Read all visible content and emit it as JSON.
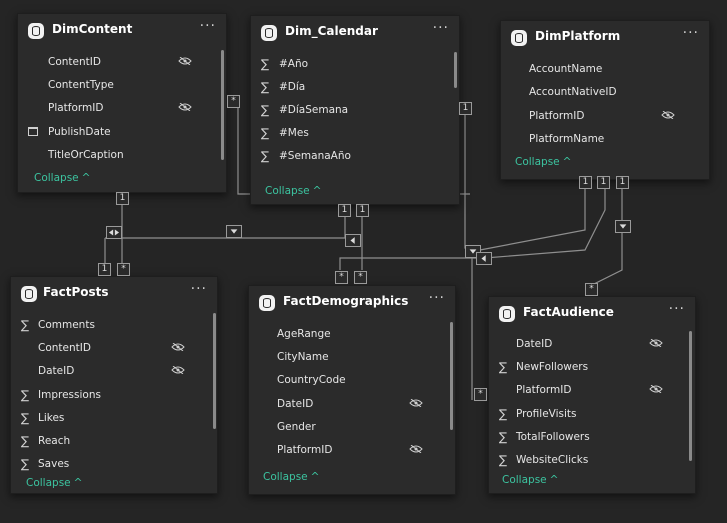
{
  "tables": {
    "dimcontent": {
      "title": "DimContent",
      "more": "···",
      "fields": [
        {
          "name": "ContentID",
          "icon": "none",
          "hidden": true
        },
        {
          "name": "ContentType",
          "icon": "none",
          "hidden": false
        },
        {
          "name": "PlatformID",
          "icon": "none",
          "hidden": true
        },
        {
          "name": "PublishDate",
          "icon": "calendar-icon",
          "hidden": false
        },
        {
          "name": "TitleOrCaption",
          "icon": "none",
          "hidden": false
        }
      ],
      "collapse": "Collapse"
    },
    "dim_calendar": {
      "title": "Dim_Calendar",
      "more": "···",
      "fields": [
        {
          "name": "#Año",
          "icon": "sigma",
          "hidden": false
        },
        {
          "name": "#Día",
          "icon": "sigma",
          "hidden": false
        },
        {
          "name": "#DíaSemana",
          "icon": "sigma",
          "hidden": false
        },
        {
          "name": "#Mes",
          "icon": "sigma",
          "hidden": false
        },
        {
          "name": "#SemanaAño",
          "icon": "sigma",
          "hidden": false
        }
      ],
      "collapse": "Collapse"
    },
    "dimplatform": {
      "title": "DimPlatform",
      "more": "···",
      "fields": [
        {
          "name": "AccountName",
          "icon": "none",
          "hidden": false
        },
        {
          "name": "AccountNativeID",
          "icon": "none",
          "hidden": false
        },
        {
          "name": "PlatformID",
          "icon": "none",
          "hidden": true
        },
        {
          "name": "PlatformName",
          "icon": "none",
          "hidden": false
        }
      ],
      "collapse": "Collapse"
    },
    "factposts": {
      "title": "FactPosts",
      "more": "···",
      "fields": [
        {
          "name": "Comments",
          "icon": "sigma",
          "hidden": false
        },
        {
          "name": "ContentID",
          "icon": "none",
          "hidden": true
        },
        {
          "name": "DateID",
          "icon": "none",
          "hidden": true
        },
        {
          "name": "Impressions",
          "icon": "sigma",
          "hidden": false
        },
        {
          "name": "Likes",
          "icon": "sigma",
          "hidden": false
        },
        {
          "name": "Reach",
          "icon": "sigma",
          "hidden": false
        },
        {
          "name": "Saves",
          "icon": "sigma",
          "hidden": false
        }
      ],
      "collapse": "Collapse"
    },
    "factdemographics": {
      "title": "FactDemographics",
      "more": "···",
      "fields": [
        {
          "name": "AgeRange",
          "icon": "none",
          "hidden": false
        },
        {
          "name": "CityName",
          "icon": "none",
          "hidden": false
        },
        {
          "name": "CountryCode",
          "icon": "none",
          "hidden": false
        },
        {
          "name": "DateID",
          "icon": "none",
          "hidden": true
        },
        {
          "name": "Gender",
          "icon": "none",
          "hidden": false
        },
        {
          "name": "PlatformID",
          "icon": "none",
          "hidden": true
        }
      ],
      "collapse": "Collapse"
    },
    "factaudience": {
      "title": "FactAudience",
      "more": "···",
      "fields": [
        {
          "name": "DateID",
          "icon": "none",
          "hidden": true
        },
        {
          "name": "NewFollowers",
          "icon": "sigma",
          "hidden": false
        },
        {
          "name": "PlatformID",
          "icon": "none",
          "hidden": true
        },
        {
          "name": "ProfileVisits",
          "icon": "sigma",
          "hidden": false
        },
        {
          "name": "TotalFollowers",
          "icon": "sigma",
          "hidden": false
        },
        {
          "name": "WebsiteClicks",
          "icon": "sigma",
          "hidden": false
        }
      ],
      "collapse": "Collapse"
    }
  },
  "cardinality": {
    "one": "1",
    "many": "*"
  },
  "colors": {
    "canvas": "#252525",
    "card": "#2b2b2b",
    "accent": "#3cc4a0",
    "line": "#8f8f8f"
  }
}
